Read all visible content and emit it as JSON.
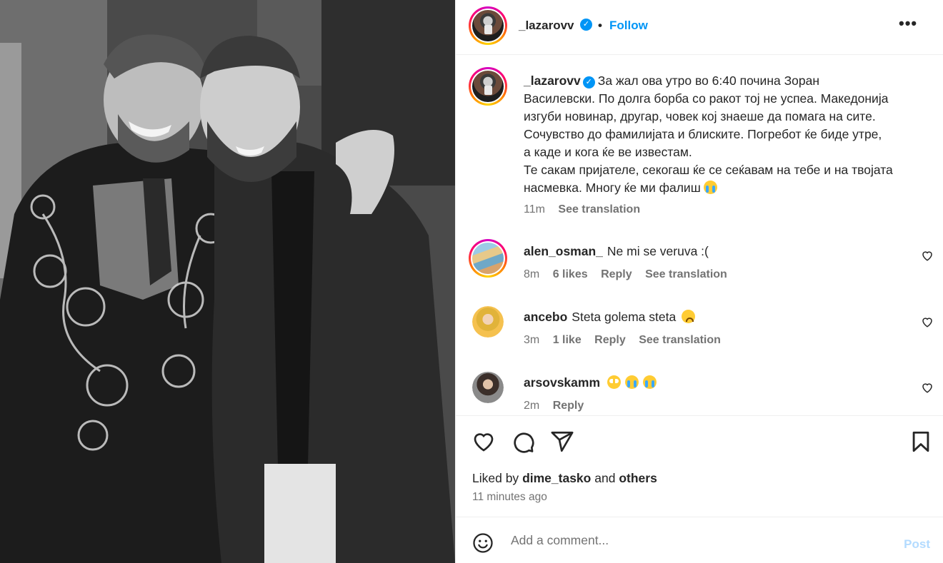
{
  "post": {
    "author": "_lazarovv",
    "follow_label": "Follow",
    "separator": "•",
    "more_label": "•••",
    "verified_mark": "✓"
  },
  "caption": {
    "username": "_lazarovv",
    "lines": [
      "За жал ова утро во 6:40 почина Зоран",
      "Василевски. По долга борба со ракот тој не успеа. Македонија",
      "изгуби новинар, другар, човек кој знаеше да помага на сите.",
      "Сочувство до фамилијата и блиските. Погребот ќе биде утре,",
      "а каде и кога ќе ве известам.",
      "Те сакам пријателе, секогаш ќе се сеќавам на тебе и на твојата",
      "насмевка. Многу ќе ми фалиш"
    ],
    "time": "11m",
    "see_translation": "See translation"
  },
  "comments": [
    {
      "username": "alen_osman_",
      "text": "Ne mi se veruva :(",
      "time": "8m",
      "likes": "6 likes",
      "reply": "Reply",
      "see_translation": "See translation"
    },
    {
      "username": "ancebo",
      "text": "Steta golema steta",
      "time": "3m",
      "likes": "1 like",
      "reply": "Reply",
      "see_translation": "See translation"
    },
    {
      "username": "arsovskamm",
      "text": "",
      "time": "2m",
      "reply": "Reply"
    }
  ],
  "likes": {
    "prefix": "Liked by",
    "user": "dime_tasko",
    "conj": "and",
    "others": "others",
    "time_ago": "11 minutes ago"
  },
  "add_comment": {
    "placeholder": "Add a comment...",
    "post_label": "Post"
  },
  "colors": {
    "accent": "#0095f6",
    "muted": "#737373",
    "text": "#262626",
    "post_disabled": "#b3dbff"
  }
}
